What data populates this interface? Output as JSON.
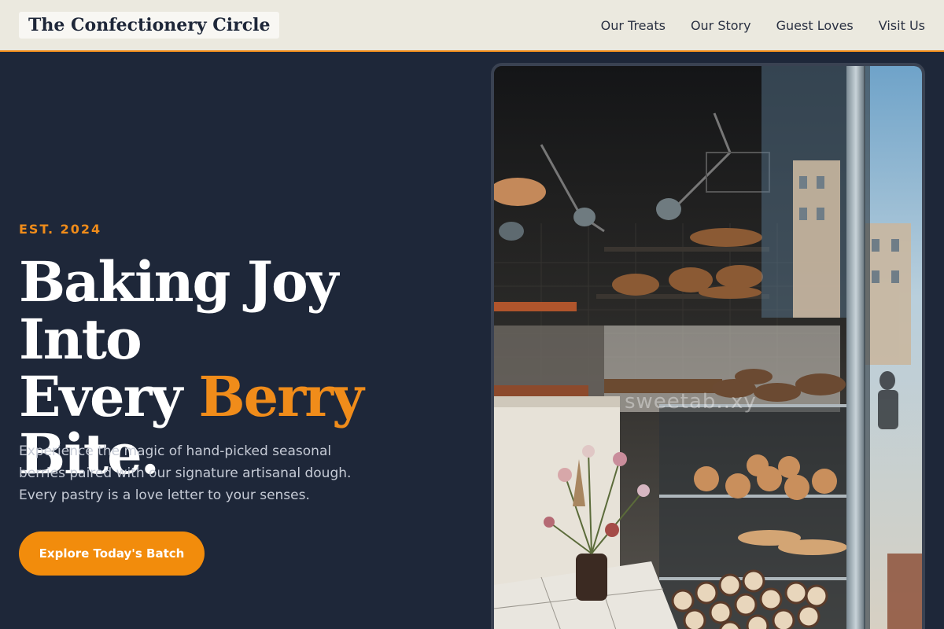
{
  "nav": {
    "logo": "The Confectionery Circle",
    "links": [
      {
        "label": "Our Treats"
      },
      {
        "label": "Our Story"
      },
      {
        "label": "Guest Loves"
      },
      {
        "label": "Visit Us"
      }
    ]
  },
  "hero": {
    "eyebrow": "EST. 2024",
    "headline_line1": "Baking Joy Into",
    "headline_line2_pre": "Every ",
    "headline_accent": "Berry",
    "headline_line3": "Bite.",
    "description": "Experience the magic of hand-picked seasonal berries paired with our signature artisanal dough. Every pastry is a love letter to your senses.",
    "cta_label": "Explore Today's Batch"
  },
  "image": {
    "watermark": "sweetab..xy"
  },
  "colors": {
    "background": "#1e2739",
    "nav_background": "#ebe9df",
    "accent": "#f08c1a",
    "text_light": "#c6cbd6"
  }
}
